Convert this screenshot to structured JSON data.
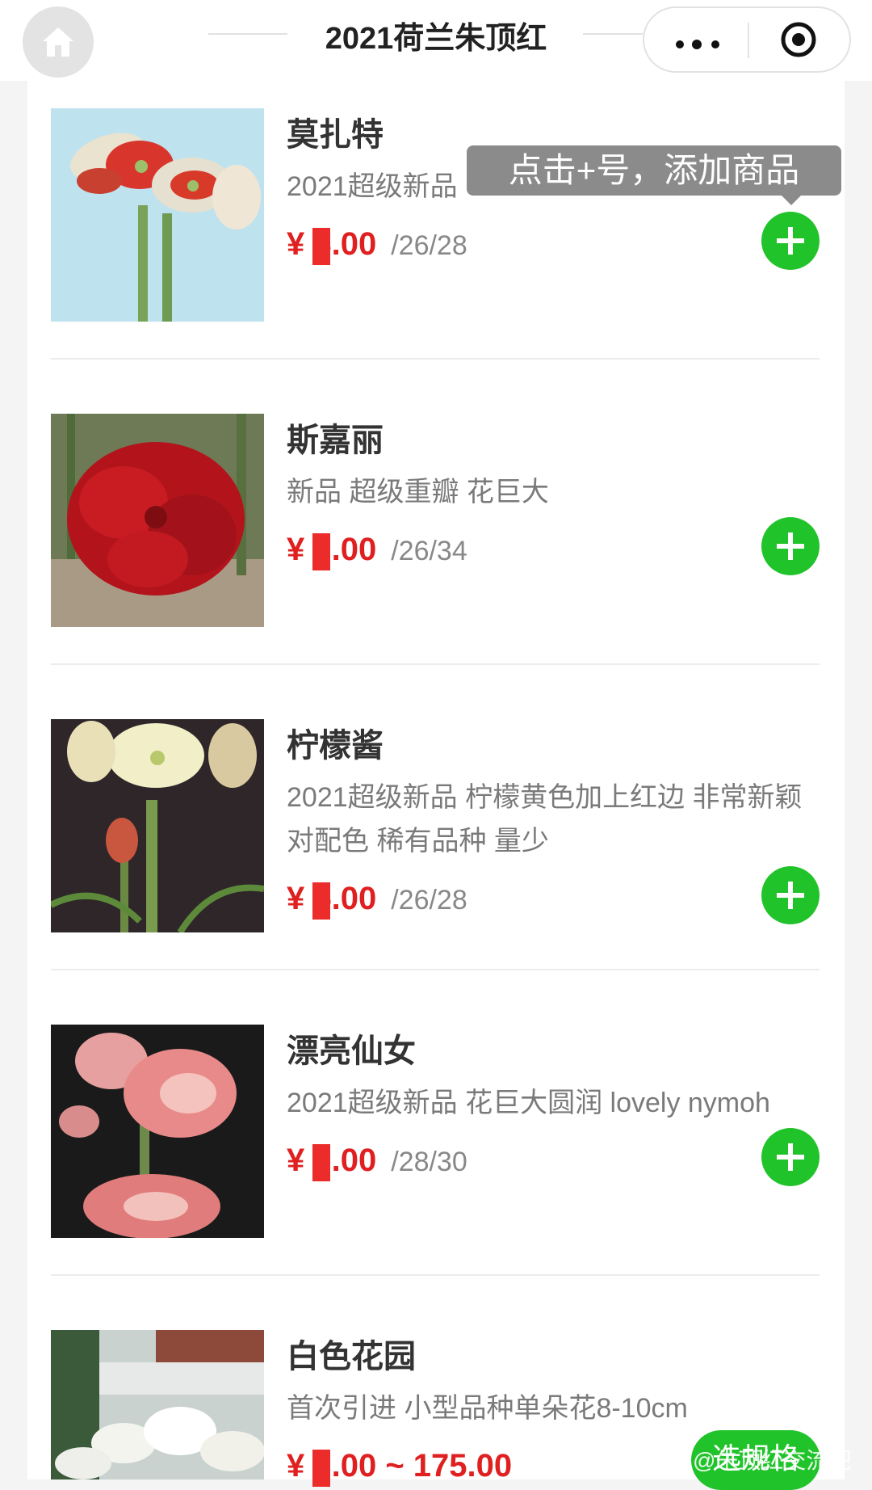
{
  "header": {
    "title": "2021荷兰朱顶红"
  },
  "tooltip": "点击+号，添加商品",
  "products": [
    {
      "name": "莫扎特",
      "desc": "2021超级新品",
      "price": "¥ 8.00",
      "spec": "/26/28"
    },
    {
      "name": "斯嘉丽",
      "desc": "新品 超级重瓣 花巨大",
      "price": "¥ 0.00",
      "spec": "/26/34"
    },
    {
      "name": "柠檬酱",
      "desc": "2021超级新品 柠檬黄色加上红边 非常新颖对配色 稀有品种 量少",
      "price": "¥ 5.00",
      "spec": "/26/28"
    },
    {
      "name": "漂亮仙女",
      "desc": "2021超级新品 花巨大圆润 lovely nymoh",
      "price": "¥ 0.00",
      "spec": "/28/30"
    },
    {
      "name": "白色花园",
      "desc": "首次引进 小型品种单朵花8-10cm",
      "price": "¥ 0.00 ~ 175.00",
      "spec": ""
    }
  ],
  "spec_button": "选规格",
  "watermark": "@朱顶红交流吧",
  "colors": {
    "accent": "#21c32b",
    "price": "#e02020"
  },
  "icons": {
    "home": "home-icon",
    "more": "more-dots-icon",
    "target": "target-icon",
    "add": "plus-icon"
  }
}
